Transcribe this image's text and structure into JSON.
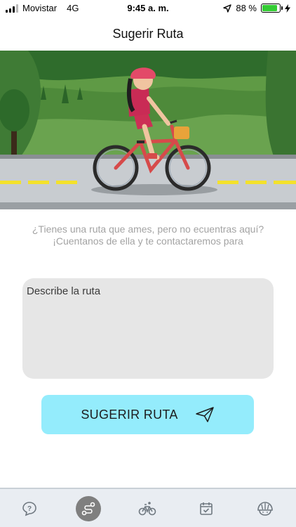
{
  "status_bar": {
    "carrier": "Movistar",
    "network": "4G",
    "time": "9:45 a. m.",
    "battery_percent": "88 %",
    "battery_level": 0.88
  },
  "header": {
    "title": "Sugerir Ruta"
  },
  "intro": {
    "line1": "¿Tienes una ruta que ames, pero no ecuentras aquí?",
    "line2": "¡Cuentanos de ella y te contactaremos para"
  },
  "form": {
    "route_placeholder": "Describe la ruta",
    "route_value": "",
    "submit_label": "SUGERIR RUTA"
  },
  "tabs": [
    {
      "icon": "help-icon",
      "active": false
    },
    {
      "icon": "route-icon",
      "active": true
    },
    {
      "icon": "bicycle-icon",
      "active": false
    },
    {
      "icon": "calendar-check-icon",
      "active": false
    },
    {
      "icon": "helmet-icon",
      "active": false
    }
  ],
  "colors": {
    "accent_button": "#94ecfc",
    "active_tab": "#7f7f7f",
    "battery": "#33cc33",
    "hint_text": "#a3a3a3"
  }
}
